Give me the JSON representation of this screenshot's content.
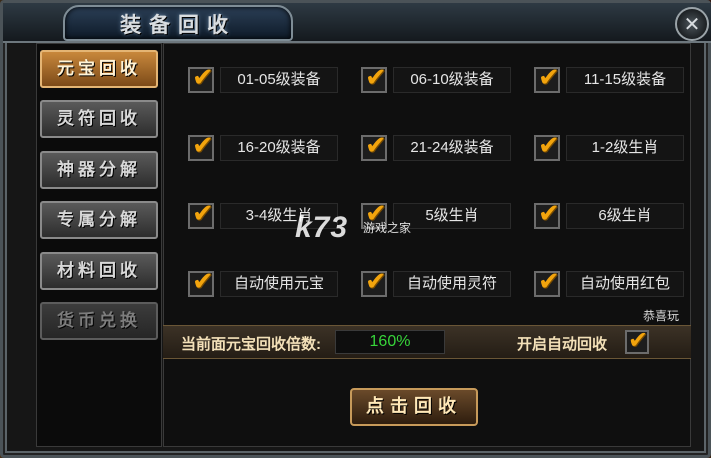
{
  "window": {
    "title": "装备回收",
    "close_icon": "close-icon"
  },
  "sidebar": {
    "items": [
      {
        "label": "元宝回收",
        "state": "active"
      },
      {
        "label": "灵符回收",
        "state": "normal"
      },
      {
        "label": "神器分解",
        "state": "normal"
      },
      {
        "label": "专属分解",
        "state": "normal"
      },
      {
        "label": "材料回收",
        "state": "normal"
      },
      {
        "label": "货币兑换",
        "state": "disabled"
      }
    ]
  },
  "options": [
    {
      "label": "01-05级装备",
      "checked": true
    },
    {
      "label": "06-10级装备",
      "checked": true
    },
    {
      "label": "11-15级装备",
      "checked": true
    },
    {
      "label": "16-20级装备",
      "checked": true
    },
    {
      "label": "21-24级装备",
      "checked": true
    },
    {
      "label": "1-2级生肖",
      "checked": true
    },
    {
      "label": "3-4级生肖",
      "checked": true
    },
    {
      "label": "5级生肖",
      "checked": true
    },
    {
      "label": "6级生肖",
      "checked": true
    },
    {
      "label": "自动使用元宝",
      "checked": true
    },
    {
      "label": "自动使用灵符",
      "checked": true
    },
    {
      "label": "自动使用红包",
      "checked": true
    }
  ],
  "notice": "恭喜玩",
  "rate": {
    "label": "当前面元宝回收倍数:",
    "value": "160%",
    "value_color": "#37d43a"
  },
  "auto_recycle": {
    "label": "开启自动回收",
    "checked": true
  },
  "recycle_button": "点击回收",
  "watermark": {
    "logo": "k73",
    "sub": "游戏之家"
  },
  "colors": {
    "accent": "#f2a40d",
    "active_tab": "#c8883c"
  }
}
